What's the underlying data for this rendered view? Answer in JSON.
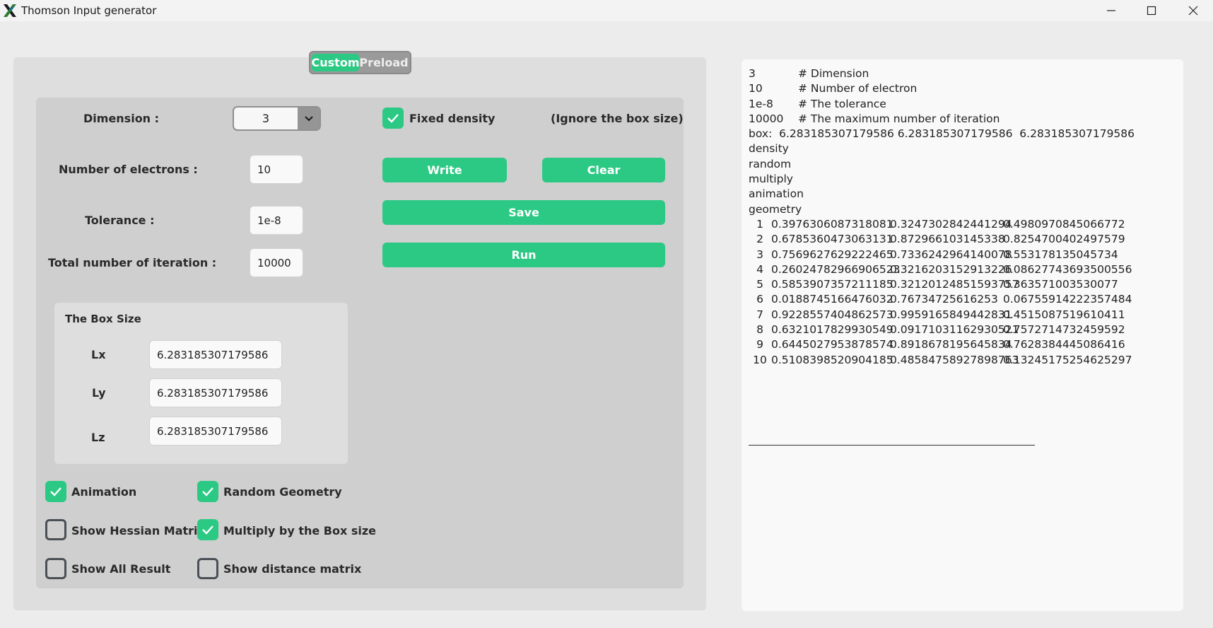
{
  "window": {
    "title": "Thomson Input generator",
    "icon": "x-logo-icon",
    "controls": [
      "minimize-icon",
      "maximize-icon",
      "close-icon"
    ]
  },
  "mode_selector": {
    "options": [
      "Custom",
      "Preload"
    ],
    "selected": "Custom"
  },
  "form": {
    "dimension_label": "Dimension :",
    "dimension_value": "3",
    "electrons_label": "Number  of electrons :",
    "electrons_value": "10",
    "tolerance_label": "Tolerance :",
    "tolerance_value": "1e-8",
    "iterations_label": "Total number of iteration :",
    "iterations_value": "10000",
    "fixed_density_label": "Fixed density",
    "fixed_density_checked": true,
    "ignore_note": "(Ignore the box size)"
  },
  "buttons": {
    "write": "Write",
    "clear": "Clear",
    "save": "Save",
    "run": "Run"
  },
  "box_size": {
    "title": "The Box Size",
    "lx_label": "Lx",
    "lx_value": "6.283185307179586",
    "ly_label": "Ly",
    "ly_value": "6.283185307179586",
    "lz_label": "Lz",
    "lz_value": "6.283185307179586"
  },
  "options": {
    "animation": {
      "label": "Animation",
      "checked": true
    },
    "random_geometry": {
      "label": "Random Geometry",
      "checked": true
    },
    "show_hessian": {
      "label": "Show Hessian Matrix",
      "checked": false
    },
    "multiply_box": {
      "label": "Multiply by the Box size",
      "checked": true
    },
    "show_all": {
      "label": "Show All Result",
      "checked": false
    },
    "show_distance": {
      "label": "Show distance matrix",
      "checked": false
    }
  },
  "output": {
    "header": [
      {
        "k": "3",
        "v": "# Dimension"
      },
      {
        "k": "10",
        "v": "# Number of electron"
      },
      {
        "k": "1e-8",
        "v": "# The tolerance"
      },
      {
        "k": "10000",
        "v": "# The maximum number of iteration"
      }
    ],
    "box_line": "box:  6.283185307179586 6.283185307179586  6.283185307179586",
    "flags": [
      "density",
      "random",
      "multiply",
      "animation",
      "geometry"
    ],
    "geometry": [
      [
        "1",
        "0.3976306087318081",
        "0.3247302842441294",
        "0.4980970845066772"
      ],
      [
        "2",
        "0.6785360473063131",
        "0.872966103145338",
        "0.8254700402497579"
      ],
      [
        "3",
        "0.7569627629222465",
        "0.7336242964140078",
        "0.553178135045734"
      ],
      [
        "4",
        "0.26024782966906523",
        "0.3216203152913226",
        "0.08627743693500556"
      ],
      [
        "5",
        "0.5853907357211185",
        "0.32120124851593757",
        "0.363571003530077"
      ],
      [
        "6",
        "0.0188745166476032",
        "0.76734725616253",
        "0.06755914222357484"
      ],
      [
        "7",
        "0.9228557404862573",
        "0.9959165849442831",
        "0.4515087519610411"
      ],
      [
        "8",
        "0.6321017829930549",
        "0.09171031162930521",
        "0.7572714732459592"
      ],
      [
        "9",
        "0.6445027953878574",
        "0.8918678195645834",
        "0.7628384445086416"
      ],
      [
        "10",
        "0.5108398520904185",
        "0.48584758927898763",
        "0.13245175254625297"
      ]
    ]
  },
  "colors": {
    "accent": "#2cc985",
    "panel": "#dedede",
    "inner": "#cfcfcf",
    "output_bg": "#f9f9f9"
  }
}
